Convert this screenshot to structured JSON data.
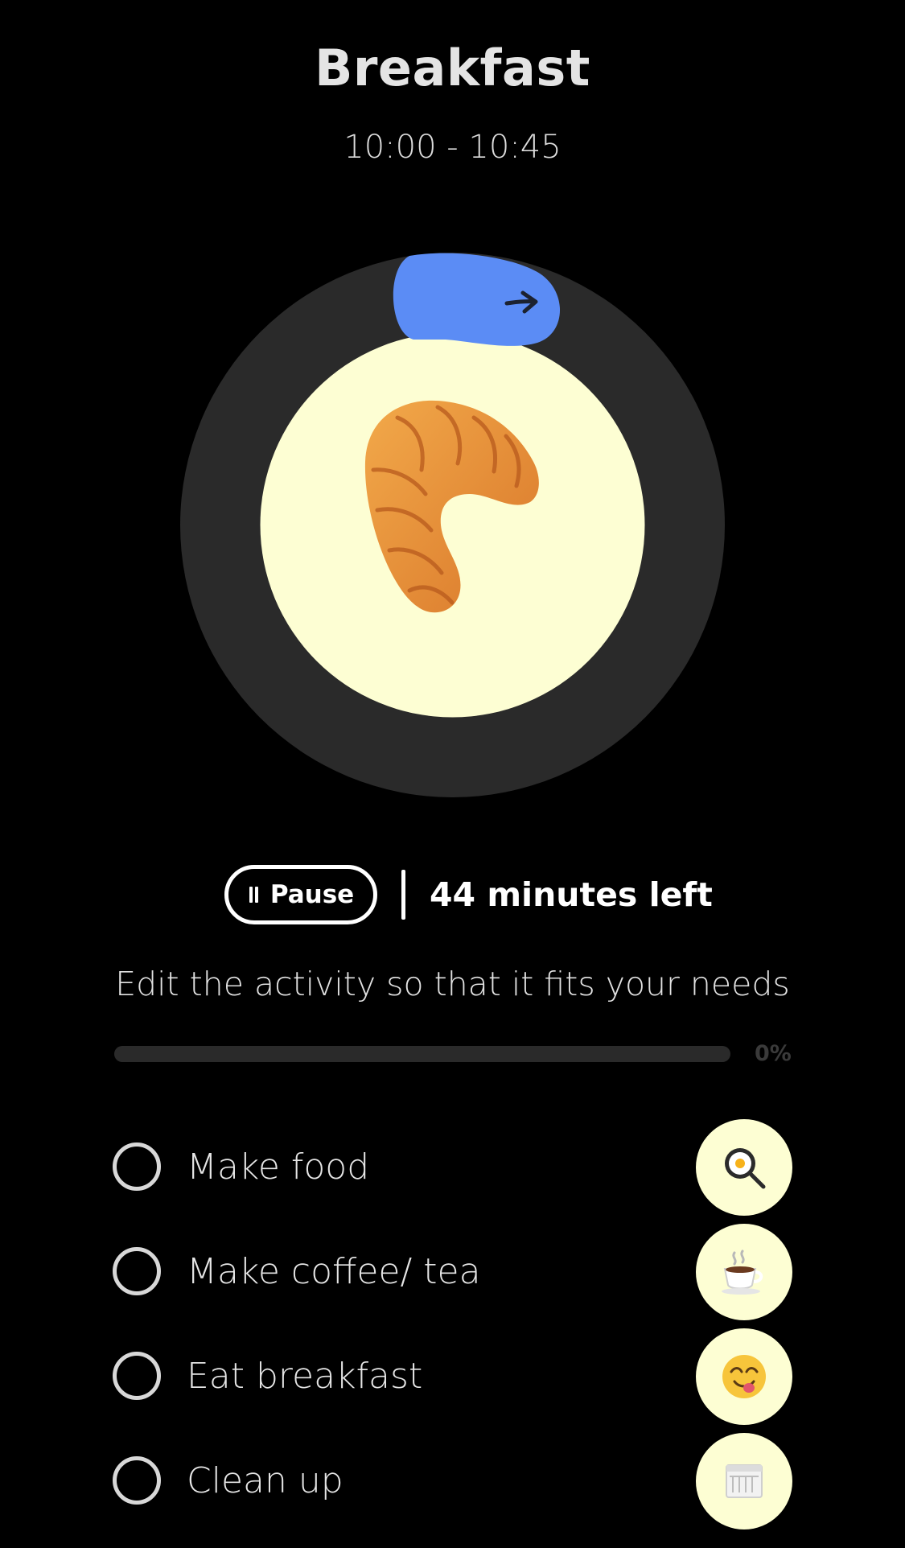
{
  "header": {
    "title": "Breakfast",
    "time_range": "10:00 - 10:45"
  },
  "dial": {
    "activity_icon": "croissant-icon",
    "progress_fraction": 0.02,
    "colors": {
      "track": "#2a2a2a",
      "center": "#fdfed3",
      "handle": "#5b8cf5"
    }
  },
  "controls": {
    "pause_label": "Pause",
    "remaining_label": "44 minutes left"
  },
  "hint": "Edit the activity so that it fits your needs",
  "progress": {
    "value": 0,
    "label": "0%"
  },
  "tasks": [
    {
      "label": "Make food",
      "icon": "frying-pan-egg-icon",
      "done": false
    },
    {
      "label": "Make coffee/ tea",
      "icon": "hot-coffee-icon",
      "done": false
    },
    {
      "label": "Eat breakfast",
      "icon": "yum-face-icon",
      "done": false
    },
    {
      "label": "Clean up",
      "icon": "dishwasher-icon",
      "done": false
    }
  ]
}
